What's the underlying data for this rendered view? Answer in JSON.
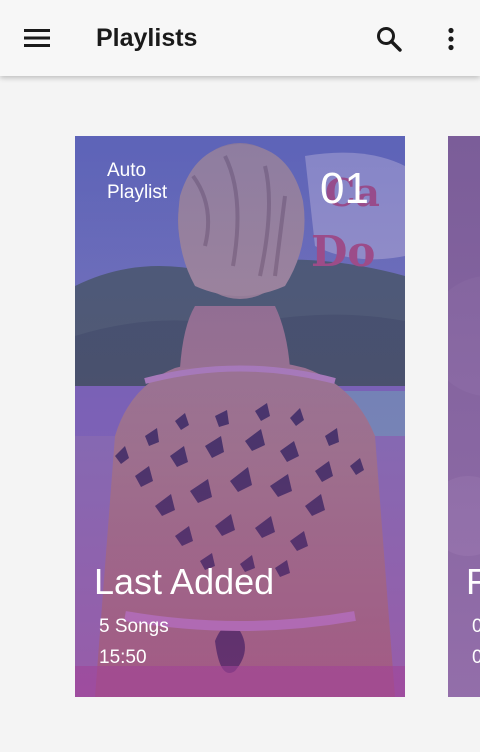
{
  "toolbar": {
    "title": "Playlists",
    "menu_icon": "menu-icon",
    "search_icon": "search-icon",
    "more_icon": "more-vert-icon"
  },
  "playlists": [
    {
      "label": "Auto\nPlaylist",
      "number": "01",
      "name": "Last Added",
      "songs": "5 Songs",
      "duration": "15:50"
    },
    {
      "name": "F",
      "songs": "0",
      "duration": "0"
    }
  ],
  "colors": {
    "overlay": "#5448aa",
    "toolbar_bg": "#f7f7f7",
    "page_bg": "#f4f4f4"
  }
}
